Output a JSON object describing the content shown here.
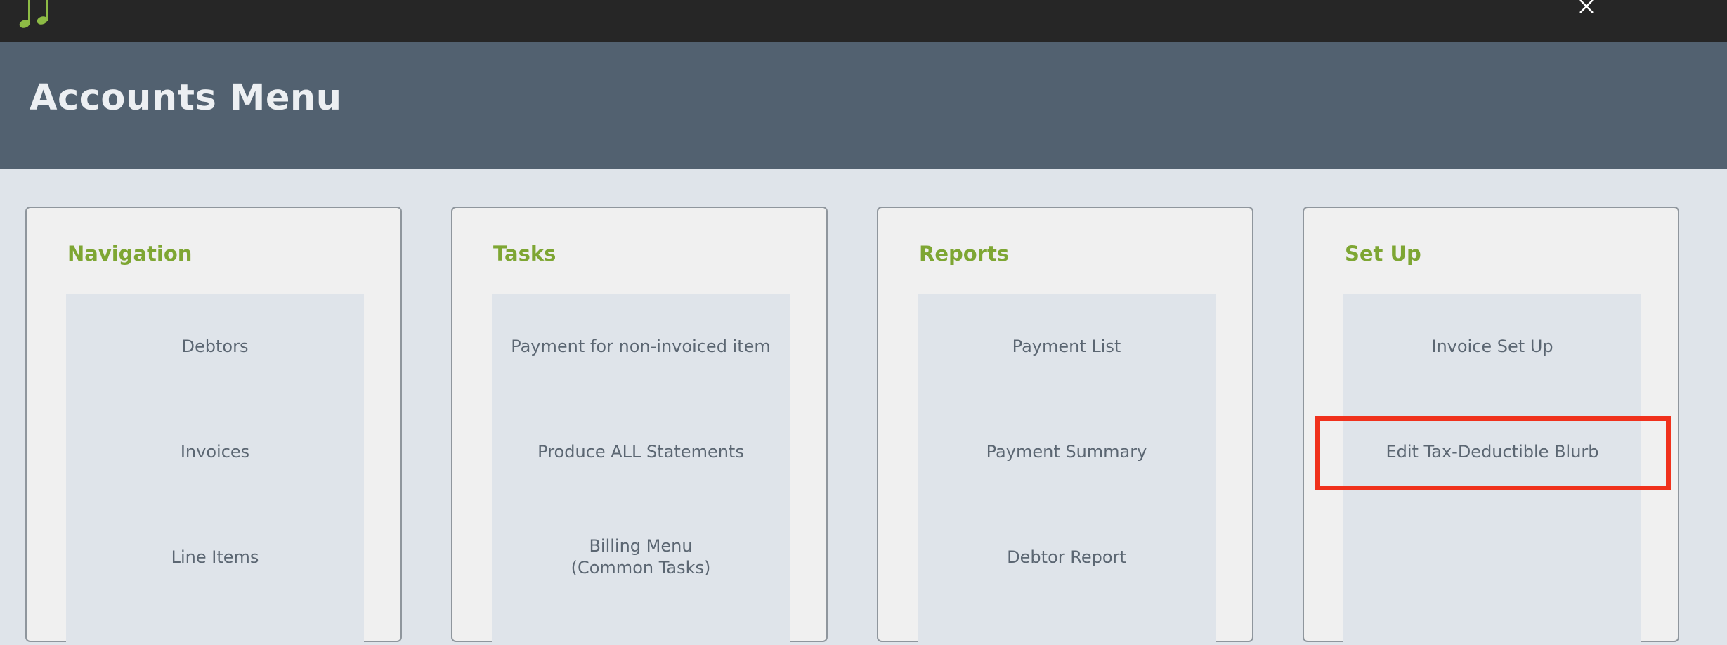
{
  "header": {
    "title": "Accounts Menu"
  },
  "topbar": {
    "logo_icon": "music-notes-icon",
    "close_icon": "close-icon"
  },
  "panels": [
    {
      "title": "Navigation",
      "buttons": [
        "Debtors",
        "Invoices",
        "Line Items"
      ]
    },
    {
      "title": "Tasks",
      "buttons": [
        "Payment for non-invoiced item",
        "Produce ALL Statements",
        "Billing Menu\n(Common Tasks)"
      ]
    },
    {
      "title": "Reports",
      "buttons": [
        "Payment List",
        "Payment Summary",
        "Debtor Report"
      ]
    },
    {
      "title": "Set Up",
      "buttons": [
        "Invoice Set Up",
        "Edit Tax-Deductible Blurb",
        ""
      ]
    }
  ],
  "colors": {
    "topbar": "#262626",
    "header": "#526170",
    "accent_green": "#7ea633",
    "highlight_red": "#f0311c"
  }
}
